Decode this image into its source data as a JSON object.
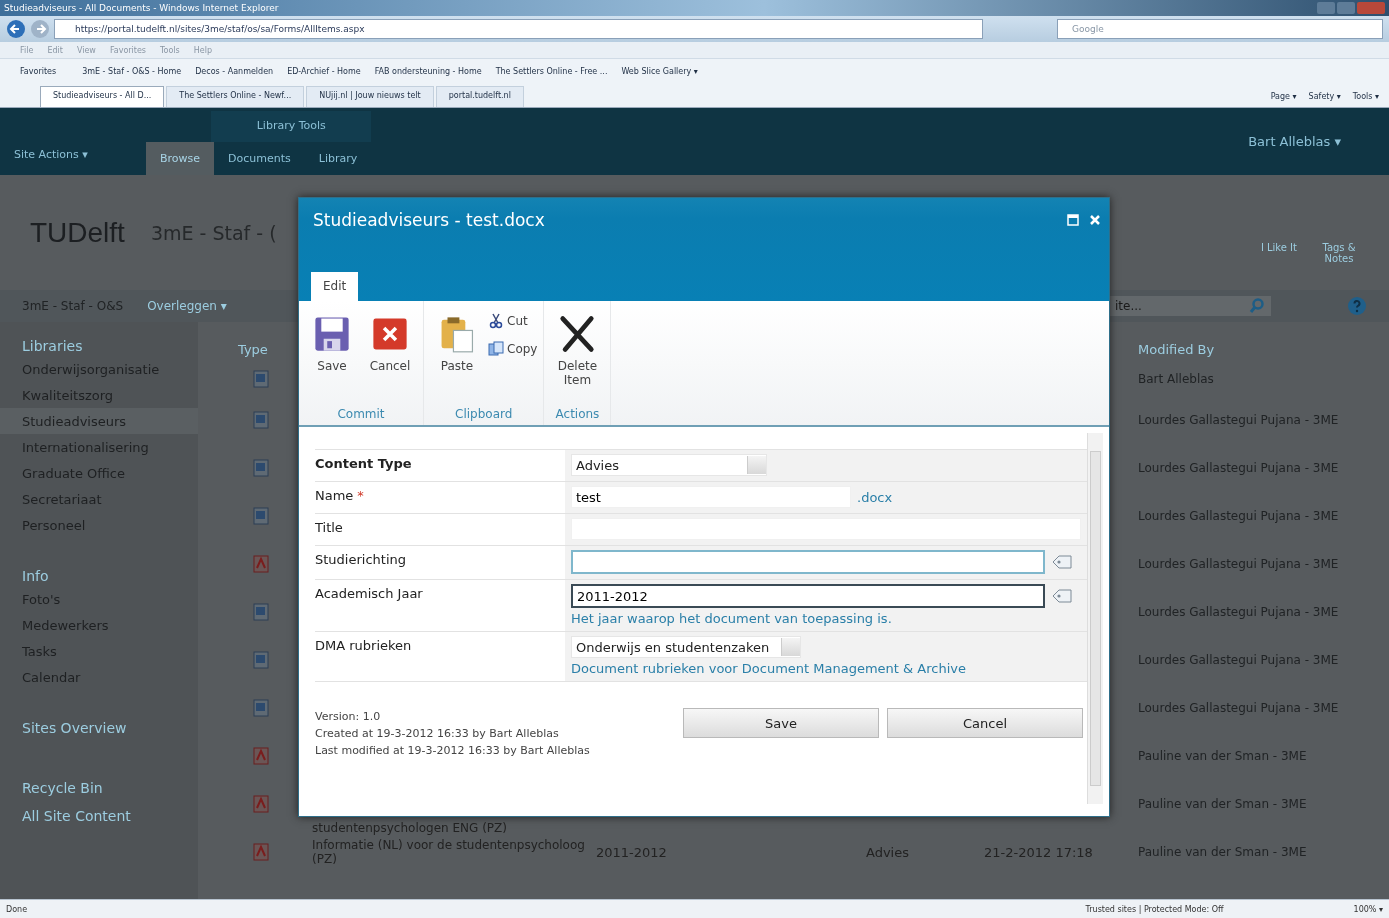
{
  "browser": {
    "title": "Studieadviseurs - All Documents - Windows Internet Explorer",
    "address": "https://portal.tudelft.nl/sites/3me/staf/os/sa/Forms/AllItems.aspx",
    "search_placeholder": "Google",
    "menu": [
      "File",
      "Edit",
      "View",
      "Favorites",
      "Tools",
      "Help"
    ],
    "favorites_label": "Favorites",
    "favorites": [
      "3mE - Staf - O&S - Home",
      "Decos - Aanmelden",
      "ED-Archief - Home",
      "FAB ondersteuning - Home",
      "The Settlers Online - Free ...",
      "Web Slice Gallery ▾"
    ],
    "tabs": [
      {
        "label": "Studieadviseurs - All D...",
        "selected": true
      },
      {
        "label": "The Settlers Online - Newf...",
        "selected": false
      },
      {
        "label": "NUjij.nl | Jouw nieuws telt",
        "selected": false
      },
      {
        "label": "portal.tudelft.nl",
        "selected": false
      }
    ],
    "commands": [
      "Page ▾",
      "Safety ▾",
      "Tools ▾"
    ]
  },
  "sharepoint": {
    "site_actions": "Site Actions ▾",
    "tool_group": "Library Tools",
    "ribbon_tabs": [
      {
        "label": "Browse",
        "selected": true
      },
      {
        "label": "Documents",
        "selected": false
      },
      {
        "label": "Library",
        "selected": false
      }
    ],
    "user": "Bart Alleblas ▾",
    "logo": "TUDelft",
    "site_title": "3mE - Staf - (",
    "social": [
      "I Like It",
      "Tags & Notes"
    ],
    "breadcrumb": "3mE - Staf - O&S",
    "top_nav": "Overleggen ▾",
    "search_placeholder": "ite...",
    "nav": [
      {
        "heading": "Libraries",
        "items": [
          {
            "label": "Onderwijsorganisatie",
            "selected": false
          },
          {
            "label": "Kwaliteitszorg",
            "selected": false
          },
          {
            "label": "Studieadviseurs",
            "selected": true
          },
          {
            "label": "Internationalisering",
            "selected": false
          },
          {
            "label": "Graduate Office",
            "selected": false
          },
          {
            "label": "Secretariaat",
            "selected": false
          },
          {
            "label": "Personeel",
            "selected": false
          }
        ]
      },
      {
        "heading": "Info",
        "items": [
          {
            "label": "Foto's",
            "selected": false
          },
          {
            "label": "Medewerkers",
            "selected": false
          },
          {
            "label": "Tasks",
            "selected": false
          },
          {
            "label": "Calendar",
            "selected": false
          }
        ]
      },
      {
        "heading": "Sites Overview"
      }
    ],
    "nav_footer": [
      "Recycle Bin",
      "All Site Content"
    ],
    "columns": {
      "type": "Type",
      "modified_by": "Modified By"
    },
    "rows": [
      {
        "kind": "doc",
        "modified_by": "Bart Alleblas"
      },
      {
        "kind": "doc",
        "modified_by": "Lourdes Gallastegui Pujana - 3ME"
      },
      {
        "kind": "doc",
        "modified_by": "Lourdes Gallastegui Pujana - 3ME"
      },
      {
        "kind": "doc",
        "modified_by": "Lourdes Gallastegui Pujana - 3ME"
      },
      {
        "kind": "pdf",
        "modified_by": "Lourdes Gallastegui Pujana - 3ME"
      },
      {
        "kind": "doc",
        "modified_by": "Lourdes Gallastegui Pujana - 3ME"
      },
      {
        "kind": "doc",
        "modified_by": "Lourdes Gallastegui Pujana - 3ME"
      },
      {
        "kind": "doc",
        "modified_by": "Lourdes Gallastegui Pujana - 3ME"
      },
      {
        "kind": "pdf",
        "modified_by": "Pauline van der Sman - 3ME"
      },
      {
        "kind": "pdf",
        "name_continued": "studentenpsychologen ENG (PZ)",
        "modified_by": "Pauline van der Sman - 3ME"
      },
      {
        "kind": "pdf",
        "name": "Informatie (NL) voor de studentenpsycholoog (PZ)",
        "year": "2011-2012",
        "content_type": "Advies",
        "modified": "21-2-2012 17:18",
        "modified_by": "Pauline van der Sman - 3ME"
      }
    ]
  },
  "dialog": {
    "title": "Studieadviseurs - test.docx",
    "tabs": [
      {
        "label": "Edit",
        "selected": true
      }
    ],
    "groups": [
      {
        "label": "Commit",
        "items": [
          {
            "kind": "save",
            "label": "Save"
          },
          {
            "kind": "cancel",
            "label": "Cancel"
          }
        ]
      },
      {
        "label": "Clipboard",
        "items": [
          {
            "kind": "paste",
            "label": "Paste"
          },
          {
            "kind": "cut",
            "label": "Cut"
          },
          {
            "kind": "copy",
            "label": "Copy"
          }
        ]
      },
      {
        "label": "Actions",
        "items": [
          {
            "kind": "delete",
            "label": "Delete Item"
          }
        ]
      }
    ],
    "fields": [
      {
        "kind": "select",
        "label": "Content Type",
        "value": "Advies"
      },
      {
        "kind": "text",
        "label": "Name",
        "required_marker": "*",
        "value": "test",
        "suffix": ".docx"
      },
      {
        "kind": "text",
        "label": "Title"
      },
      {
        "kind": "taxonomy",
        "label": "Studierichting"
      },
      {
        "kind": "taxonomy",
        "label": "Academisch Jaar",
        "value": "2011-2012",
        "description": "Het jaar waarop het document van toepassing is."
      },
      {
        "kind": "select",
        "label": "DMA rubrieken",
        "value": "Onderwijs en studentenzaken",
        "description": "Document rubrieken voor Document Management & Archive"
      }
    ],
    "footer": [
      "Version: 1.0",
      "Created at 19-3-2012 16:33 by Bart Alleblas",
      "Last modified at 19-3-2012 16:33 by Bart Alleblas"
    ],
    "buttons": [
      "Save",
      "Cancel"
    ]
  },
  "status_bar": {
    "left": "Done",
    "zone": "Trusted sites | Protected Mode: Off",
    "zoom": "100% ▾"
  }
}
